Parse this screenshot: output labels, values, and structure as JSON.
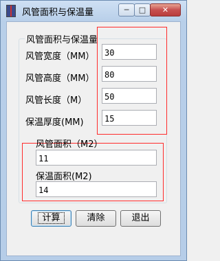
{
  "window": {
    "title": "风管面积与保温量",
    "controls": {
      "minimize": "─",
      "maximize": "□",
      "close": "✕"
    }
  },
  "group": {
    "label": "风管面积与保温量",
    "fields": [
      {
        "label": "风管宽度（MM）",
        "value": "30"
      },
      {
        "label": "风管高度（MM）",
        "value": "80"
      },
      {
        "label": "风管长度（M）",
        "value": "50"
      },
      {
        "label": "保温厚度(MM)",
        "value": "15"
      }
    ]
  },
  "results": [
    {
      "label": "风管面积（M2）",
      "value": "11"
    },
    {
      "label": "保温面积(M2)",
      "value": "14"
    }
  ],
  "buttons": {
    "calc": "计算",
    "clear": "清除",
    "exit": "退出"
  },
  "colors": {
    "highlight_box": "#ff2a2a"
  }
}
